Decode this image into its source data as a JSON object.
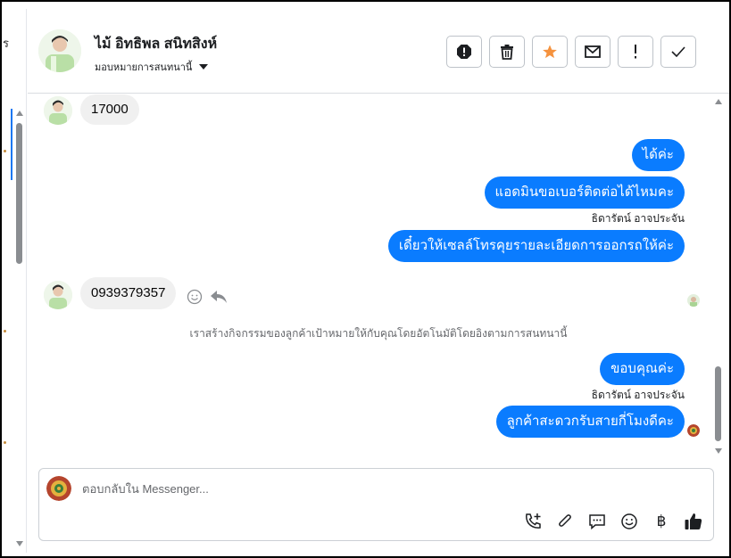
{
  "left_panel": {
    "cut_text": "ร"
  },
  "header": {
    "contact_name": "ไม้ อิทธิพล สนิทสิงห์",
    "assign_label": "มอบหมายการสนทนานี้",
    "icons": [
      "report-icon",
      "trash-icon",
      "star-icon",
      "mail-icon",
      "exclamation-icon",
      "check-icon"
    ]
  },
  "messages": {
    "m1": "17000",
    "m2": "ได้ค่ะ",
    "m3": "แอดมินขอเบอร์ติดต่อได้ไหมคะ",
    "sender1": "ธิดารัตน์ อาจประจัน",
    "m4": "เดี๋ยวให้เซลล์โทรคุยรายละเอียดการออกรถให้ค่ะ",
    "m5": "0939379357",
    "system_note": "เราสร้างกิจกรรมของลูกค้าเป้าหมายให้กับคุณโดยอัตโนมัติโดยอิงตามการสนทนานี้",
    "m6": "ขอบคุณค่ะ",
    "sender2": "ธิดารัตน์ อาจประจัน",
    "m7": "ลูกค้าสะดวกรับสายกี่โมงดีคะ"
  },
  "composer": {
    "placeholder": "ตอบกลับใน Messenger...",
    "tools": [
      "call-add-icon",
      "attachment-icon",
      "saved-reply-icon",
      "emoji-icon",
      "baht-icon",
      "thumbs-up-icon"
    ],
    "baht_symbol": "฿"
  },
  "colors": {
    "outgoing_bubble": "#0a7cff",
    "incoming_bubble": "#f0f0f0",
    "accent_star": "#f5923e"
  }
}
